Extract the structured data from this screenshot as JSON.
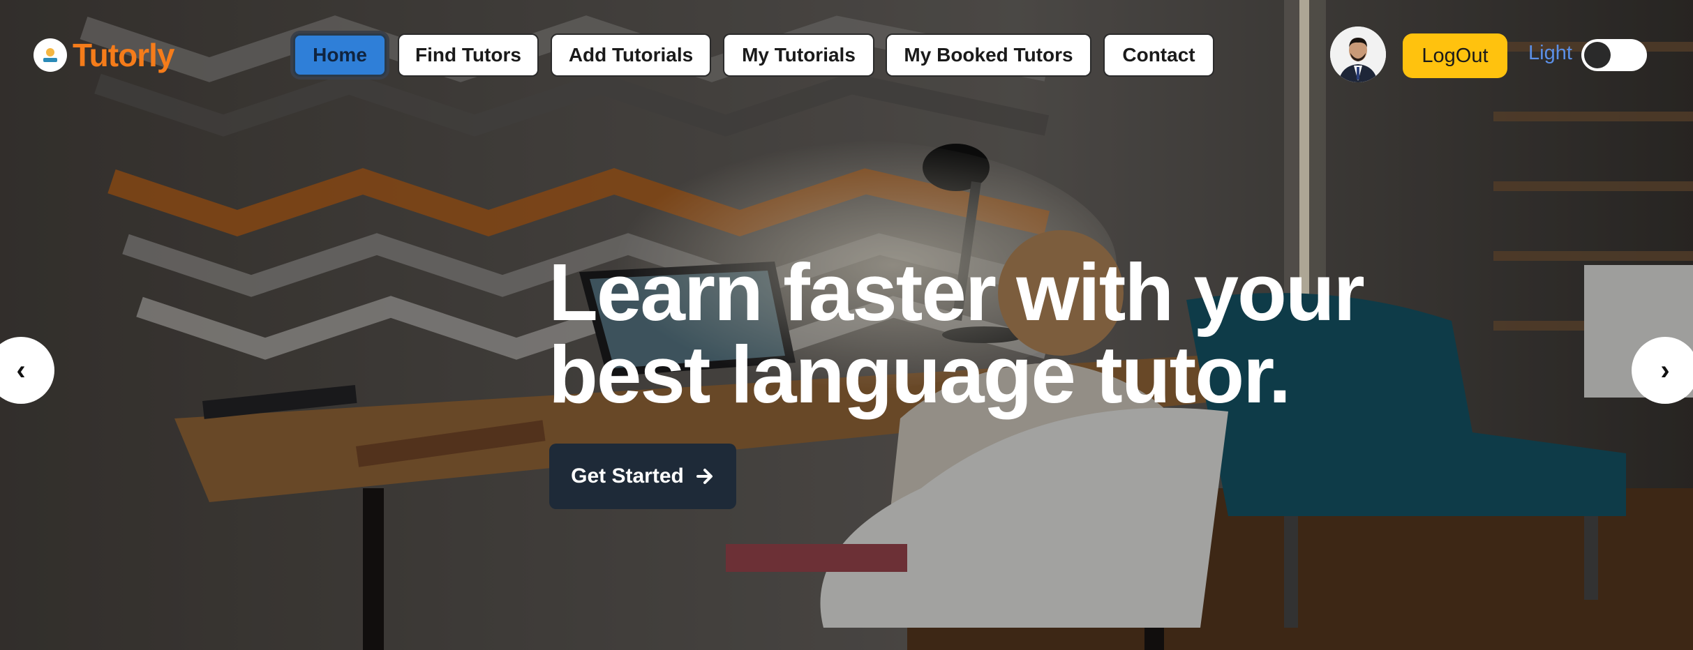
{
  "brand": {
    "name": "Tutorly",
    "logo_icon": "tutorly-logo-icon"
  },
  "nav": {
    "items": [
      {
        "label": "Home",
        "active": true
      },
      {
        "label": "Find Tutors",
        "active": false
      },
      {
        "label": "Add Tutorials",
        "active": false
      },
      {
        "label": "My Tutorials",
        "active": false
      },
      {
        "label": "My Booked Tutors",
        "active": false
      },
      {
        "label": "Contact",
        "active": false
      }
    ]
  },
  "user": {
    "avatar_icon": "user-avatar",
    "logout_label": "LogOut"
  },
  "theme": {
    "label": "Light",
    "dark_mode": false
  },
  "hero": {
    "headline_line1": "Learn faster with your",
    "headline_line2": "best language tutor.",
    "cta_label": "Get Started",
    "cta_icon": "arrow-right-icon",
    "prev_glyph": "‹",
    "next_glyph": "›"
  },
  "colors": {
    "brand": "#f57c1a",
    "active_nav": "#2f7fd8",
    "logout": "#ffc20e",
    "cta_bg": "#1e2a38",
    "theme_label": "#5b8fe6"
  }
}
